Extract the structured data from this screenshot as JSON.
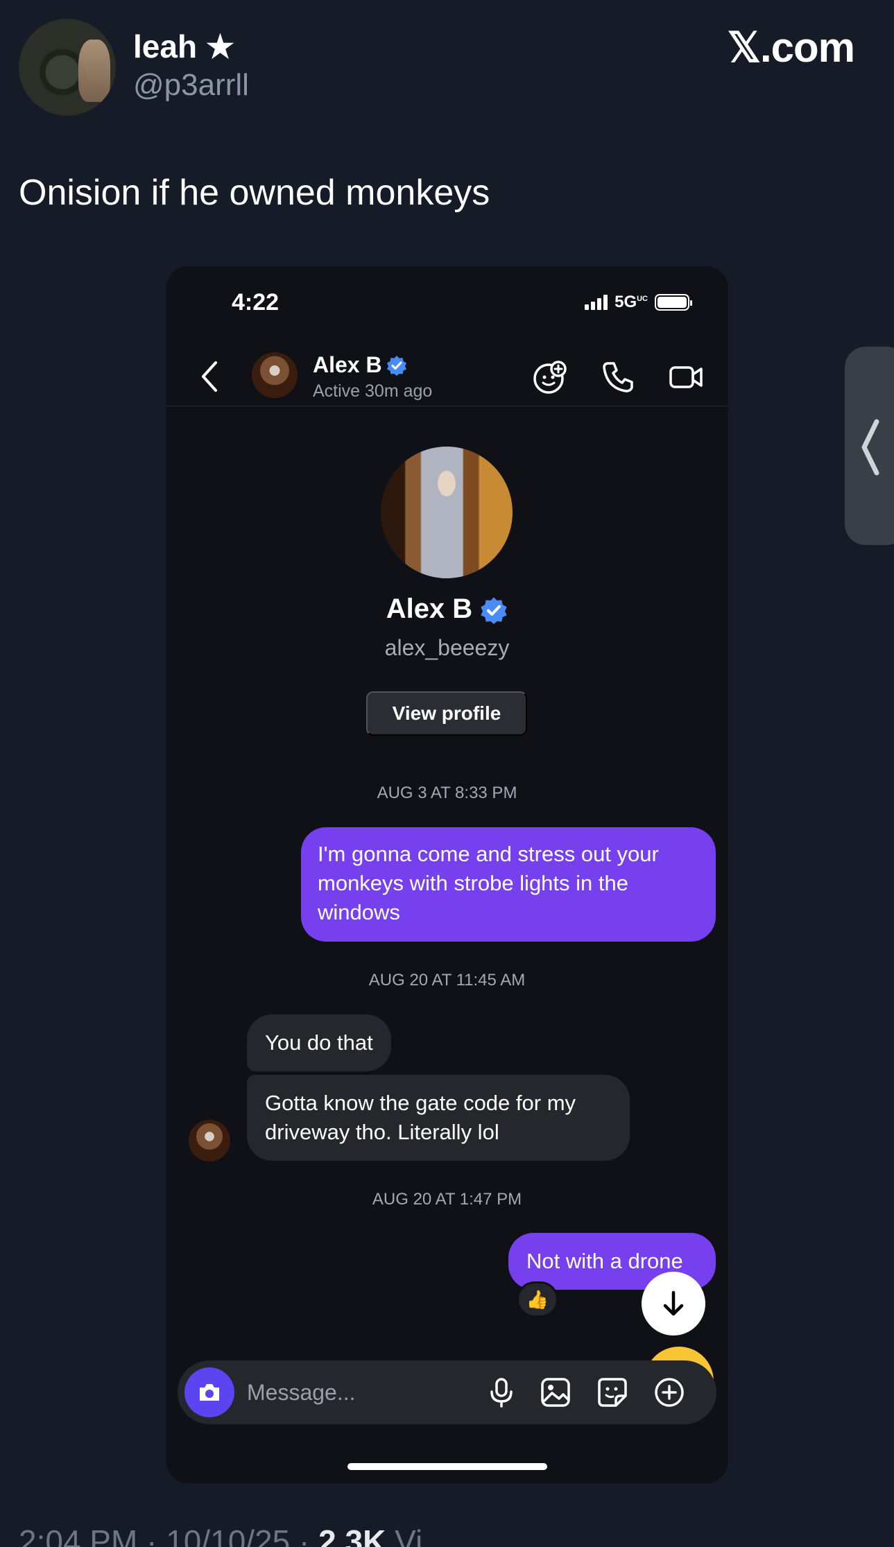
{
  "tweet": {
    "author_name": "leah ★",
    "author_handle": "@p3arrll",
    "brand": "𝕏.com",
    "text": "Onision if he owned monkeys",
    "footer_time": "2:04 PM · 10/10/25 · ",
    "footer_views_count": "2.3K",
    "footer_views_label": " Vi"
  },
  "phone": {
    "status_time": "4:22",
    "network": "5G",
    "network_sub": "UC"
  },
  "chat_header": {
    "contact_name": "Alex B",
    "contact_status": "Active 30m ago"
  },
  "profile": {
    "name": "Alex B",
    "handle": "alex_beeezy",
    "view_profile_label": "View profile"
  },
  "messages": {
    "ts1": "AUG 3 AT 8:33 PM",
    "out1": "I'm gonna come and stress out your monkeys with strobe lights in the windows",
    "ts2": "AUG 20 AT 11:45 AM",
    "in1": "You do that",
    "in2": "Gotta know the gate code for my driveway tho.  Literally lol",
    "ts3": "AUG 20 AT 1:47 PM",
    "out2": "Not with a drone",
    "reaction": "👍"
  },
  "composer": {
    "placeholder": "Message..."
  },
  "colors": {
    "background": "#151b27",
    "outgoing_bubble": "#7640ef",
    "incoming_bubble": "#25272d",
    "verified": "#4a8cf7"
  }
}
